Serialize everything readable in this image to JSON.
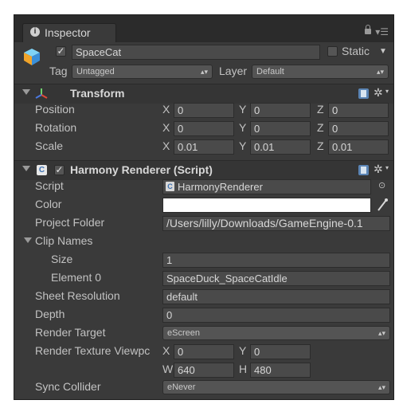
{
  "tab": {
    "label": "Inspector",
    "icon": "info-icon"
  },
  "object": {
    "name": "SpaceCat",
    "static_label": "Static",
    "tag_label": "Tag",
    "tag_value": "Untagged",
    "layer_label": "Layer",
    "layer_value": "Default"
  },
  "transform": {
    "title": "Transform",
    "rows": [
      {
        "label": "Position",
        "x": "0",
        "y": "0",
        "z": "0"
      },
      {
        "label": "Rotation",
        "x": "0",
        "y": "0",
        "z": "0"
      },
      {
        "label": "Scale",
        "x": "0.01",
        "y": "0.01",
        "z": "0.01"
      }
    ],
    "axis_x": "X",
    "axis_y": "Y",
    "axis_z": "Z"
  },
  "harmony": {
    "title": "Harmony Renderer (Script)",
    "script_label": "Script",
    "script_value": "HarmonyRenderer",
    "color_label": "Color",
    "project_folder_label": "Project Folder",
    "project_folder_value": "/Users/lilly/Downloads/GameEngine-0.1",
    "clip_names_label": "Clip Names",
    "size_label": "Size",
    "size_value": "1",
    "element0_label": "Element 0",
    "element0_value": "SpaceDuck_SpaceCatIdle",
    "sheet_resolution_label": "Sheet Resolution",
    "sheet_resolution_value": "default",
    "depth_label": "Depth",
    "depth_value": "0",
    "render_target_label": "Render Target",
    "render_target_value": "eScreen",
    "render_texture_label": "Render Texture Viewpc",
    "rt_x_label": "X",
    "rt_x_value": "0",
    "rt_y_label": "Y",
    "rt_y_value": "0",
    "rt_w_label": "W",
    "rt_w_value": "640",
    "rt_h_label": "H",
    "rt_h_value": "480",
    "sync_collider_label": "Sync Collider",
    "sync_collider_value": "eNever"
  }
}
